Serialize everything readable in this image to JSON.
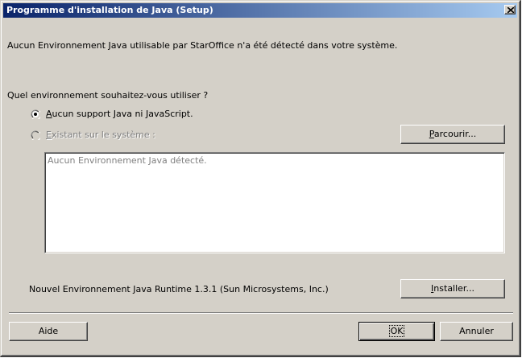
{
  "window": {
    "title": "Programme d'installation de Java (Setup)"
  },
  "content": {
    "message": "Aucun Environnement Java utilisable par StarOffice n'a été détecté dans votre système.",
    "question": "Quel environnement souhaitez-vous utiliser ?",
    "option_none": {
      "accel": "A",
      "label_rest": "ucun support Java ni JavaScript.",
      "selected": true
    },
    "option_existing": {
      "accel": "E",
      "label_rest": "xistant sur le système :",
      "selected": false,
      "enabled": false
    },
    "browse_button": {
      "accel": "P",
      "label_rest": "arcourir..."
    },
    "list_text": "Aucun Environnement Java détecté.",
    "new_runtime_text": "Nouvel Environnement Java Runtime 1.3.1 (Sun Microsystems, Inc.)",
    "install_button": {
      "accel": "I",
      "label_rest": "nstaller..."
    }
  },
  "footer": {
    "help_label": "Aide",
    "ok_label": "OK",
    "cancel_label": "Annuler"
  },
  "icons": {
    "close": "close-icon",
    "radio": "radio-button"
  },
  "colors": {
    "titlebar_start": "#0a246a",
    "titlebar_end": "#a6caf0",
    "face": "#d4d0c8"
  }
}
